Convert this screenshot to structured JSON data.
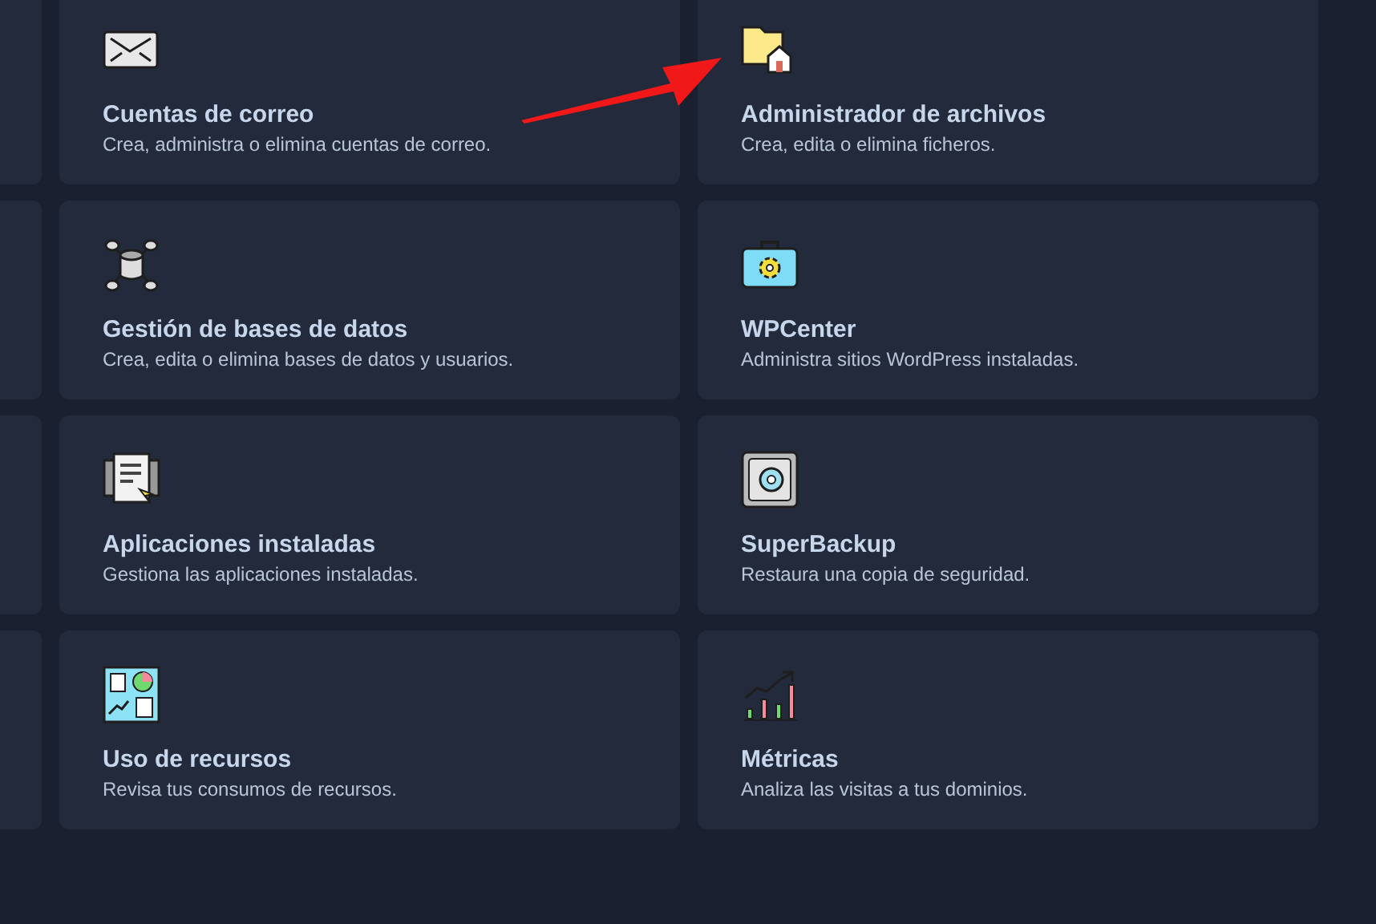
{
  "cards": [
    {
      "kind": "mail",
      "title": "Cuentas de correo",
      "description": "Crea, administra o elimina cuentas de correo."
    },
    {
      "kind": "folder",
      "title": "Administrador de archivos",
      "description": "Crea, edita o elimina ficheros."
    },
    {
      "kind": "database",
      "title": "Gestión de bases de datos",
      "description": "Crea, edita o elimina bases de datos y usuarios."
    },
    {
      "kind": "toolbox",
      "title": "WPCenter",
      "description": "Administra sitios WordPress instaladas."
    },
    {
      "kind": "apps",
      "title": "Aplicaciones instaladas",
      "description": "Gestiona las aplicaciones instaladas."
    },
    {
      "kind": "safe",
      "title": "SuperBackup",
      "description": "Restaura una copia de seguridad."
    },
    {
      "kind": "dashboard",
      "title": "Uso de recursos",
      "description": "Revisa tus consumos de recursos."
    },
    {
      "kind": "metrics",
      "title": "Métricas",
      "description": "Analiza las visitas a tus dominios."
    }
  ]
}
